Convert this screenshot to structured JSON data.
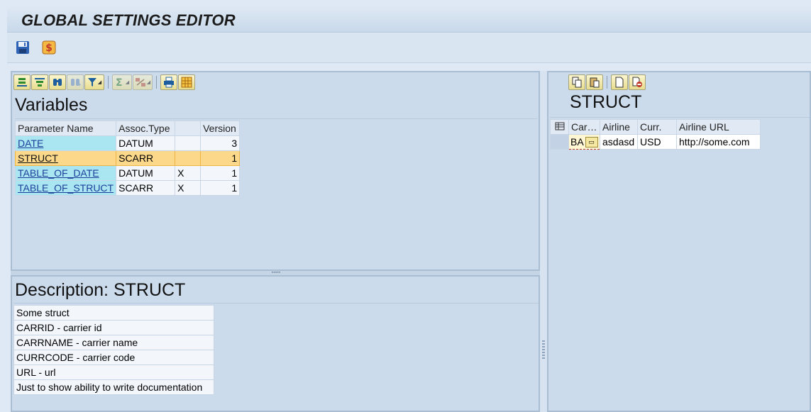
{
  "window": {
    "title": "GLOBAL SETTINGS EDITOR"
  },
  "app_toolbar": {
    "buttons": [
      {
        "icon": "save-icon",
        "label": "Save"
      },
      {
        "icon": "execute-icon",
        "label": "Execute"
      }
    ]
  },
  "variables_panel": {
    "title": "Variables",
    "toolbar": [
      "align-bottom-icon",
      "filter-icon",
      "find-icon",
      "find-next-icon",
      "set-filter-icon",
      "sum-icon",
      "subtotal-icon",
      "print-icon",
      "layout-icon"
    ],
    "columns": [
      "Parameter Name",
      "Assoc.Type",
      "",
      "Version"
    ],
    "rows": [
      {
        "name": "DATE",
        "type": "DATUM",
        "table": "",
        "version": "3"
      },
      {
        "name": "STRUCT",
        "type": "SCARR",
        "table": "",
        "version": "1"
      },
      {
        "name": "TABLE_OF_DATE",
        "type": "DATUM",
        "table": "X",
        "version": "1"
      },
      {
        "name": "TABLE_OF_STRUCT",
        "type": "SCARR",
        "table": "X",
        "version": "1"
      }
    ],
    "selected_row": "STRUCT"
  },
  "description_panel": {
    "title": "Description: STRUCT",
    "lines": [
      "Some struct",
      "CARRID - carrier id",
      "CARRNAME - carrier name",
      "CURRCODE - carrier code",
      "URL - url",
      "Just to show ability to write documentation"
    ]
  },
  "struct_panel": {
    "title": "STRUCT",
    "toolbar": [
      "copy-icon",
      "paste-icon",
      "new-row-icon",
      "delete-row-icon"
    ],
    "columns": [
      "Car…",
      "Airline",
      "Curr.",
      "Airline URL"
    ],
    "rows": [
      {
        "carrid": "BA",
        "carrname": "asdasd",
        "currcode": "USD",
        "url": "http://some.com"
      }
    ]
  },
  "colors": {
    "selected_row": "#fcd98a",
    "key_cell": "#a9e6f2",
    "pane_bg": "#ccdbec"
  }
}
